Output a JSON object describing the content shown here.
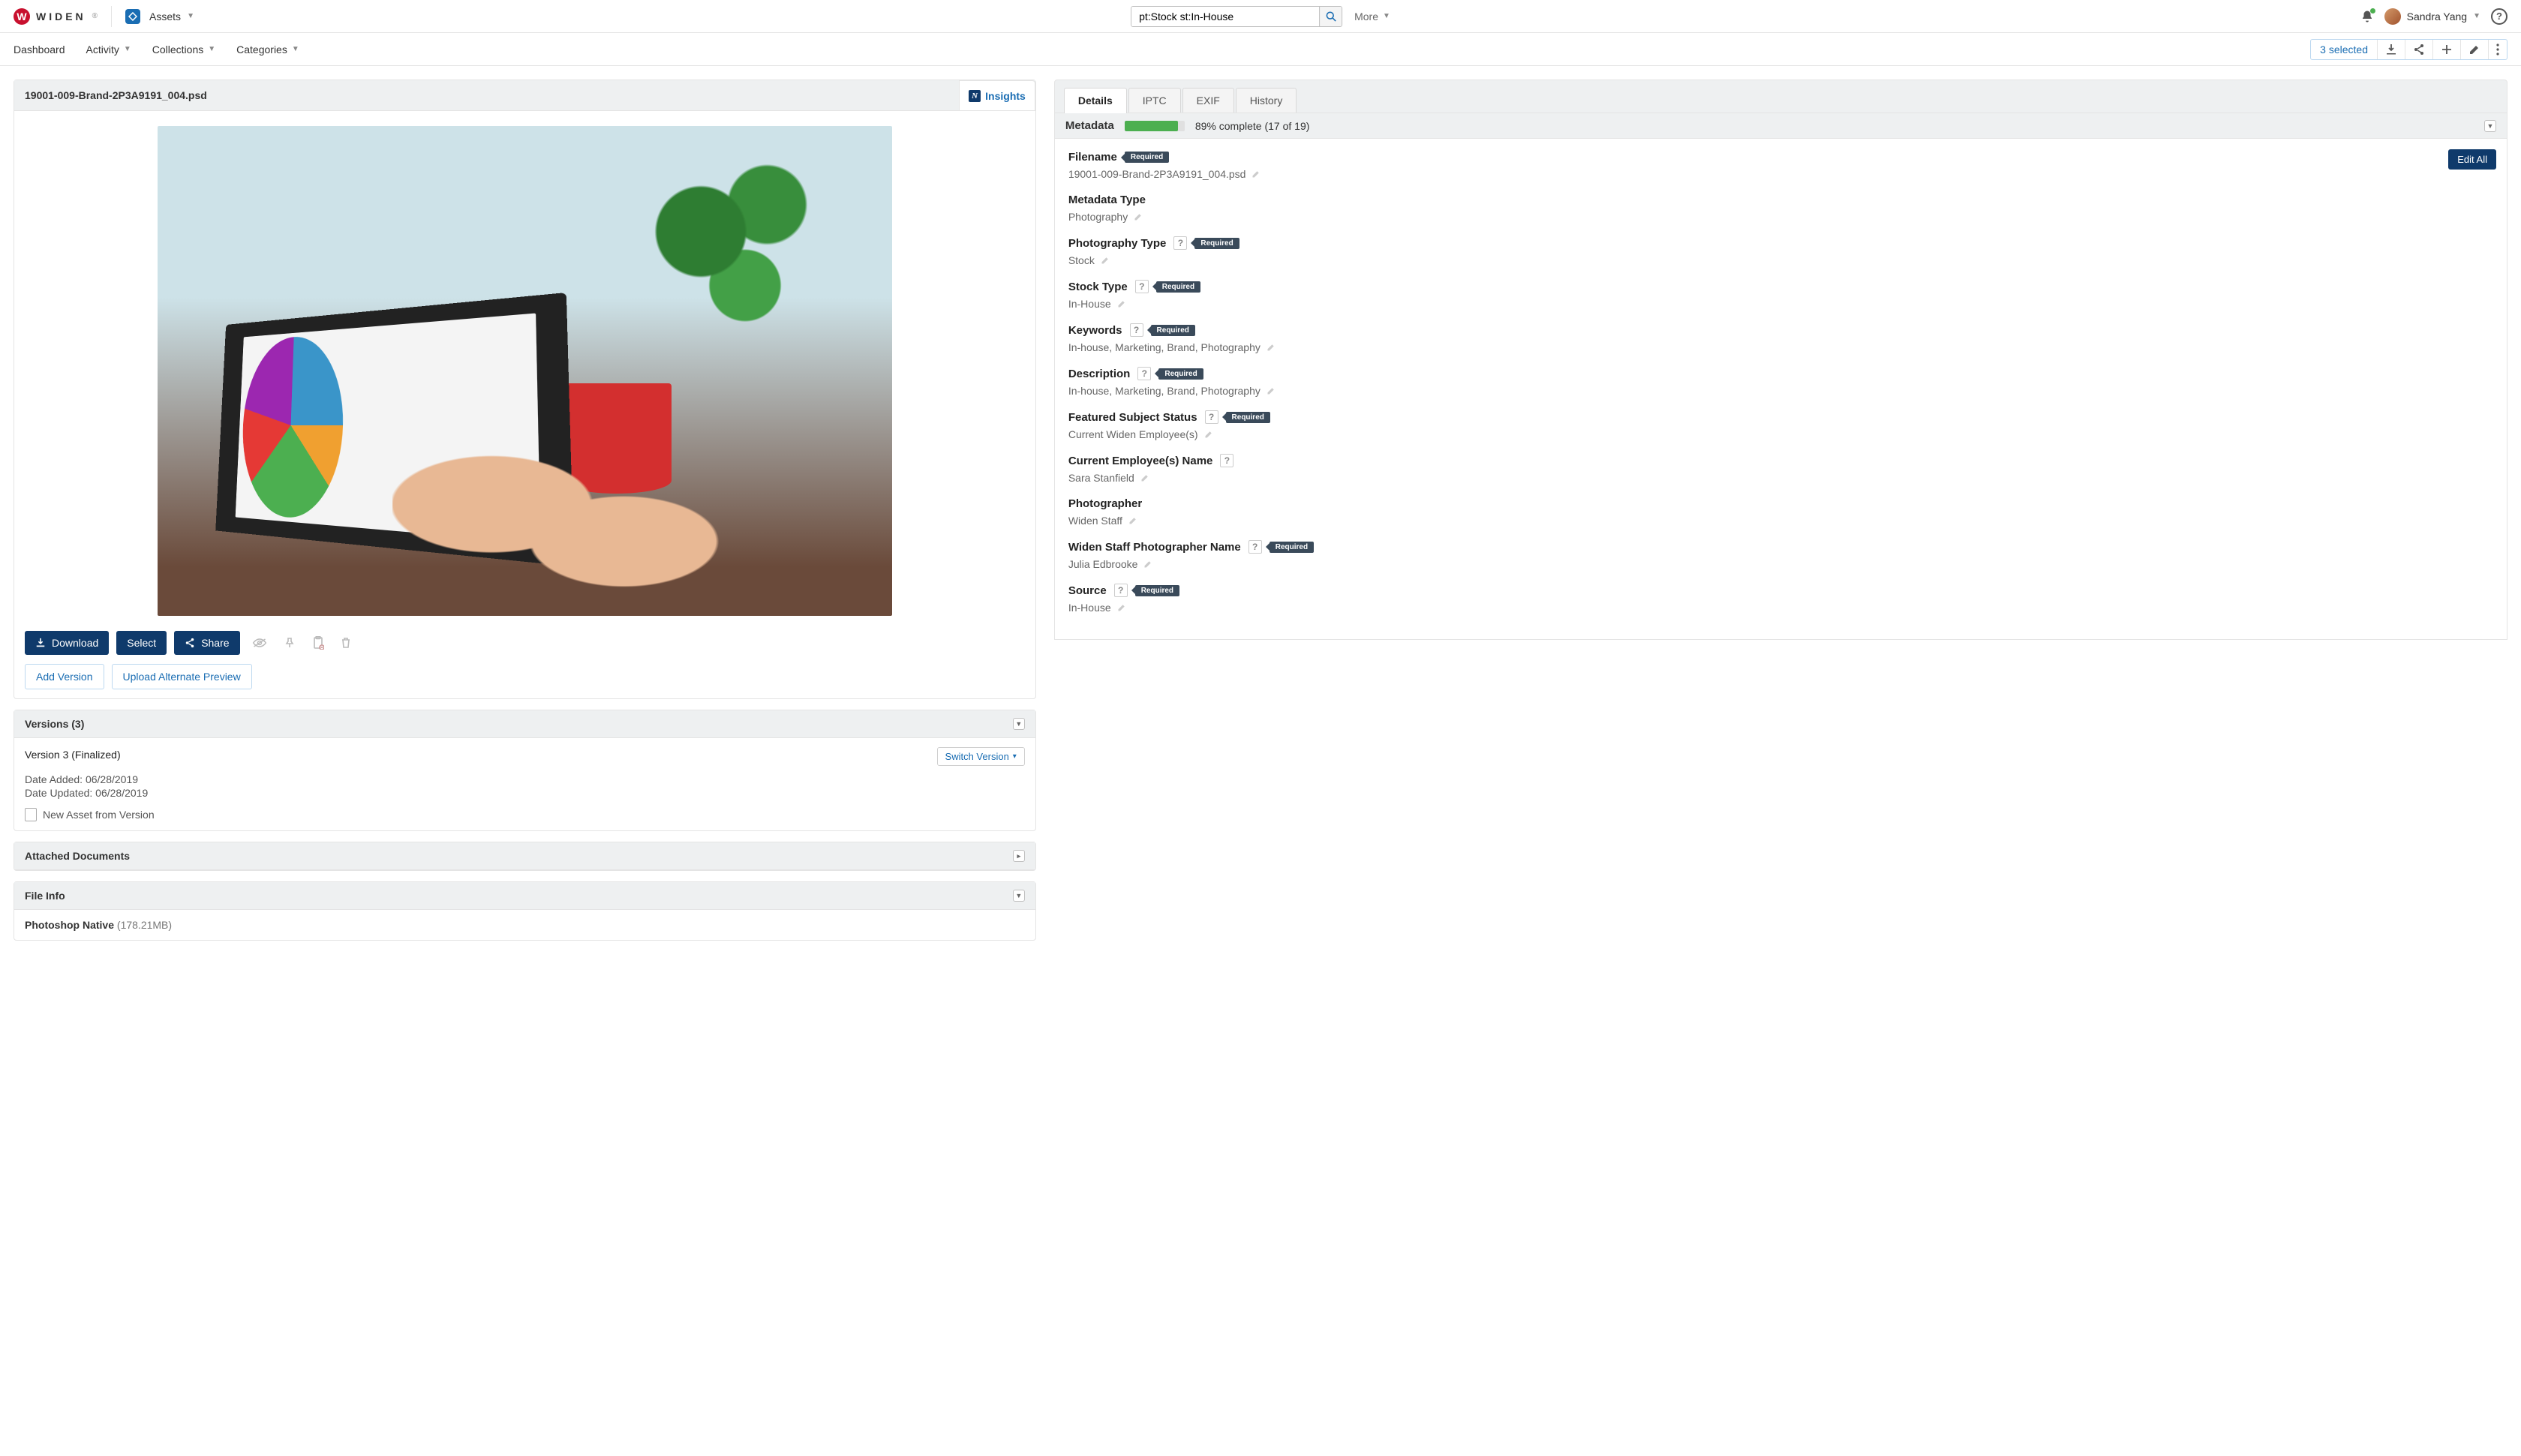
{
  "header": {
    "brand": "WIDEN",
    "assets_dropdown": "Assets",
    "search_value": "pt:Stock st:In-House",
    "more_label": "More",
    "user_name": "Sandra Yang"
  },
  "nav": {
    "items": [
      "Dashboard",
      "Activity",
      "Collections",
      "Categories"
    ],
    "selected_count": "3 selected"
  },
  "asset": {
    "filename_title": "19001-009-Brand-2P3A9191_004.psd",
    "insights_label": "Insights",
    "actions": {
      "download": "Download",
      "select": "Select",
      "share": "Share",
      "add_version": "Add Version",
      "upload_alt": "Upload Alternate Preview"
    }
  },
  "versions": {
    "panel_title": "Versions (3)",
    "current": "Version 3 (Finalized)",
    "date_added": "Date Added: 06/28/2019",
    "date_updated": "Date Updated: 06/28/2019",
    "switch_label": "Switch Version",
    "new_from_version": "New Asset from Version"
  },
  "attached_docs": {
    "panel_title": "Attached Documents"
  },
  "file_info": {
    "panel_title": "File Info",
    "format_label": "Photoshop Native",
    "format_size": "(178.21MB)"
  },
  "tabs": [
    "Details",
    "IPTC",
    "EXIF",
    "History"
  ],
  "meta_header": {
    "title": "Metadata",
    "pct": 89,
    "pct_text": "89% complete (17 of 19)",
    "edit_all": "Edit All"
  },
  "fields": [
    {
      "label": "Filename",
      "required": true,
      "help": false,
      "value": "19001-009-Brand-2P3A9191_004.psd"
    },
    {
      "label": "Metadata Type",
      "required": false,
      "help": false,
      "value": "Photography"
    },
    {
      "label": "Photography Type",
      "required": true,
      "help": true,
      "value": "Stock"
    },
    {
      "label": "Stock Type",
      "required": true,
      "help": true,
      "value": "In-House"
    },
    {
      "label": "Keywords",
      "required": true,
      "help": true,
      "value": "In-house, Marketing, Brand, Photography"
    },
    {
      "label": "Description",
      "required": true,
      "help": true,
      "value": "In-house, Marketing, Brand, Photography"
    },
    {
      "label": "Featured Subject Status",
      "required": true,
      "help": true,
      "value": "Current Widen Employee(s)"
    },
    {
      "label": "Current Employee(s) Name",
      "required": false,
      "help": true,
      "value": "Sara Stanfield"
    },
    {
      "label": "Photographer",
      "required": false,
      "help": false,
      "value": "Widen Staff"
    },
    {
      "label": "Widen Staff Photographer Name",
      "required": true,
      "help": true,
      "value": "Julia Edbrooke"
    },
    {
      "label": "Source",
      "required": true,
      "help": true,
      "value": "In-House"
    }
  ],
  "required_label": "Required"
}
